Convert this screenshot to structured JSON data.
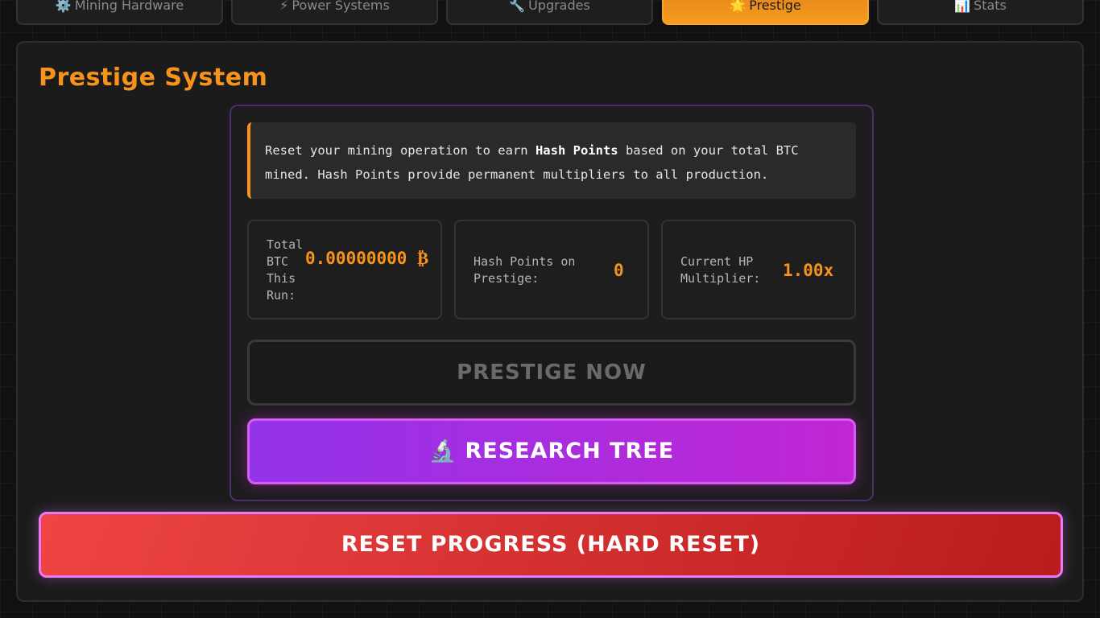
{
  "tabs": [
    {
      "icon": "⚙️",
      "icon_name": "gear-icon",
      "label": "Mining Hardware"
    },
    {
      "icon": "⚡",
      "icon_name": "lightning-icon",
      "label": "Power Systems"
    },
    {
      "icon": "🔧",
      "icon_name": "wrench-icon",
      "label": "Upgrades"
    },
    {
      "icon": "🌟",
      "icon_name": "star-icon",
      "label": "Prestige"
    },
    {
      "icon": "📊",
      "icon_name": "bar-chart-icon",
      "label": "Stats"
    }
  ],
  "active_tab": "Prestige",
  "panel": {
    "title": "Prestige System",
    "info": {
      "part1": "Reset your mining operation to earn ",
      "bold": "Hash Points",
      "part2": " based on your total BTC mined. Hash Points provide permanent multipliers to all production."
    },
    "stats": {
      "total_btc": {
        "label": "Total BTC This Run:",
        "value": "0.00000000 ₿"
      },
      "hash_points": {
        "label": "Hash Points on Prestige:",
        "value": "0"
      },
      "multiplier": {
        "label": "Current HP Multiplier:",
        "value": "1.00x"
      }
    },
    "buttons": {
      "prestige": "PRESTIGE NOW",
      "research_icon": "🔬",
      "research_icon_name": "microscope-icon",
      "research": "RESEARCH TREE",
      "reset": "RESET PROGRESS (HARD RESET)"
    }
  },
  "colors": {
    "accent": "#f7931a",
    "research_gradient": [
      "#9333ea",
      "#c026d3"
    ],
    "reset_gradient": [
      "#ef4444",
      "#b91c1c"
    ]
  }
}
